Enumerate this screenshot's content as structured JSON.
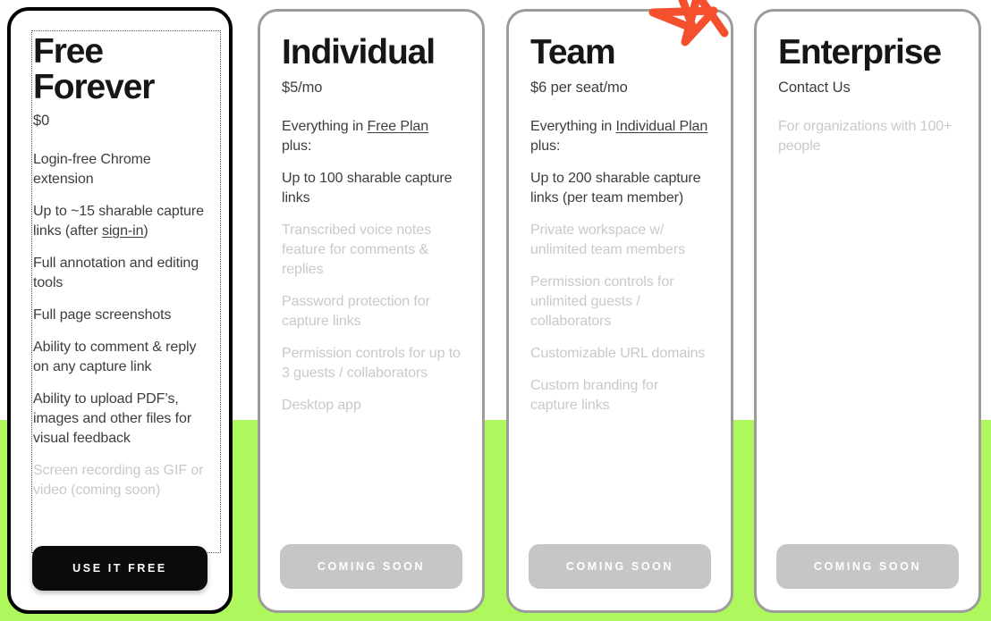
{
  "theme": {
    "background": "#ffffff",
    "band_color": "#aef85d",
    "highlight_border": "#000000",
    "card_border": "#9c9c9c",
    "text_color": "#3d3d3d",
    "muted_text_color": "#c9c9c9",
    "cta_primary_bg": "#0b0b0b",
    "cta_disabled_bg": "#c6c6c6",
    "annotation_color": "#f4502e"
  },
  "annotation": {
    "name": "star-scribble",
    "color": "#f4502e"
  },
  "plans": [
    {
      "id": "free",
      "title": "Free Forever",
      "price": "$0",
      "features": [
        {
          "text": "Login-free Chrome extension",
          "muted": false
        },
        {
          "text": "Up to ~15 sharable capture links (after sign-in)",
          "muted": false,
          "link": "sign-in"
        },
        {
          "text": "Full annotation and editing tools",
          "muted": false
        },
        {
          "text": "Full page screenshots",
          "muted": false
        },
        {
          "text": "Ability to comment & reply on any capture link",
          "muted": false
        },
        {
          "text": "Ability to upload PDF’s, images and other files for visual feedback",
          "muted": false
        },
        {
          "text": "Screen recording as GIF or video (coming soon)",
          "muted": true
        }
      ],
      "cta": "USE IT FREE"
    },
    {
      "id": "individual",
      "title": "Individual",
      "price": "$5/mo",
      "features": [
        {
          "text": "Everything in Free Plan plus:",
          "muted": false,
          "link": "Free Plan"
        },
        {
          "text": "Up to 100 sharable capture links",
          "muted": false
        },
        {
          "text": "Transcribed voice notes feature for comments & replies",
          "muted": true
        },
        {
          "text": "Password protection for capture links",
          "muted": true
        },
        {
          "text": "Permission controls for up to 3 guests / collaborators",
          "muted": true
        },
        {
          "text": "Desktop app",
          "muted": true
        }
      ],
      "cta": "COMING SOON"
    },
    {
      "id": "team",
      "title": "Team",
      "price": "$6 per seat/mo",
      "features": [
        {
          "text": "Everything in Individual Plan plus:",
          "muted": false,
          "link": "Individual Plan"
        },
        {
          "text": "Up to 200 sharable capture links (per team member)",
          "muted": false
        },
        {
          "text": "Private workspace w/ unlimited team members",
          "muted": true
        },
        {
          "text": "Permission controls for unlimited guests / collaborators",
          "muted": true
        },
        {
          "text": "Customizable URL domains",
          "muted": true
        },
        {
          "text": "Custom branding for capture links",
          "muted": true
        }
      ],
      "cta": "COMING SOON"
    },
    {
      "id": "enterprise",
      "title": "Enterprise",
      "price": "Contact Us",
      "features": [
        {
          "text": "For organizations with 100+ people",
          "muted": true
        }
      ],
      "cta": "COMING SOON"
    }
  ]
}
